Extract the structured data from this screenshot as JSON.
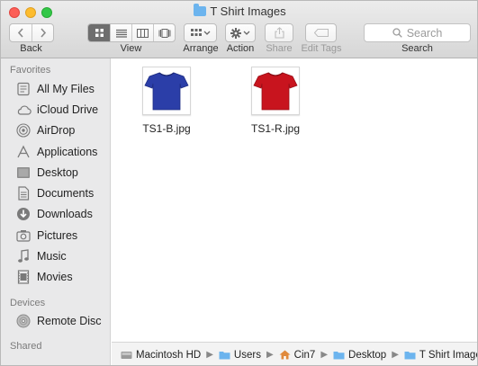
{
  "window": {
    "title": "T Shirt Images"
  },
  "toolbar": {
    "back_label": "Back",
    "view_label": "View",
    "arrange_label": "Arrange",
    "action_label": "Action",
    "share_label": "Share",
    "edit_tags_label": "Edit Tags",
    "search_placeholder": "Search",
    "search_label": "Search"
  },
  "sidebar": {
    "favorites_title": "Favorites",
    "favorites": [
      {
        "label": "All My Files",
        "icon": "all-files-icon"
      },
      {
        "label": "iCloud Drive",
        "icon": "cloud-icon"
      },
      {
        "label": "AirDrop",
        "icon": "airdrop-icon"
      },
      {
        "label": "Applications",
        "icon": "applications-icon"
      },
      {
        "label": "Desktop",
        "icon": "desktop-icon"
      },
      {
        "label": "Documents",
        "icon": "documents-icon"
      },
      {
        "label": "Downloads",
        "icon": "downloads-icon"
      },
      {
        "label": "Pictures",
        "icon": "camera-icon"
      },
      {
        "label": "Music",
        "icon": "music-icon"
      },
      {
        "label": "Movies",
        "icon": "film-icon"
      }
    ],
    "devices_title": "Devices",
    "devices": [
      {
        "label": "Remote Disc",
        "icon": "disc-icon"
      }
    ],
    "shared_title": "Shared"
  },
  "files": [
    {
      "name": "TS1-B.jpg",
      "shirt_color": "#2b3ea8"
    },
    {
      "name": "TS1-R.jpg",
      "shirt_color": "#c8141e"
    }
  ],
  "pathbar": [
    {
      "label": "Macintosh HD",
      "icon": "hard-drive-icon"
    },
    {
      "label": "Users",
      "icon": "folder-icon"
    },
    {
      "label": "Cin7",
      "icon": "home-icon"
    },
    {
      "label": "Desktop",
      "icon": "folder-icon"
    },
    {
      "label": "T Shirt Images",
      "icon": "folder-icon"
    }
  ],
  "colors": {
    "close": "#fc5f57",
    "minimize": "#fdbc2e",
    "zoom": "#33c748",
    "folder_blue": "#6cb4ee"
  }
}
